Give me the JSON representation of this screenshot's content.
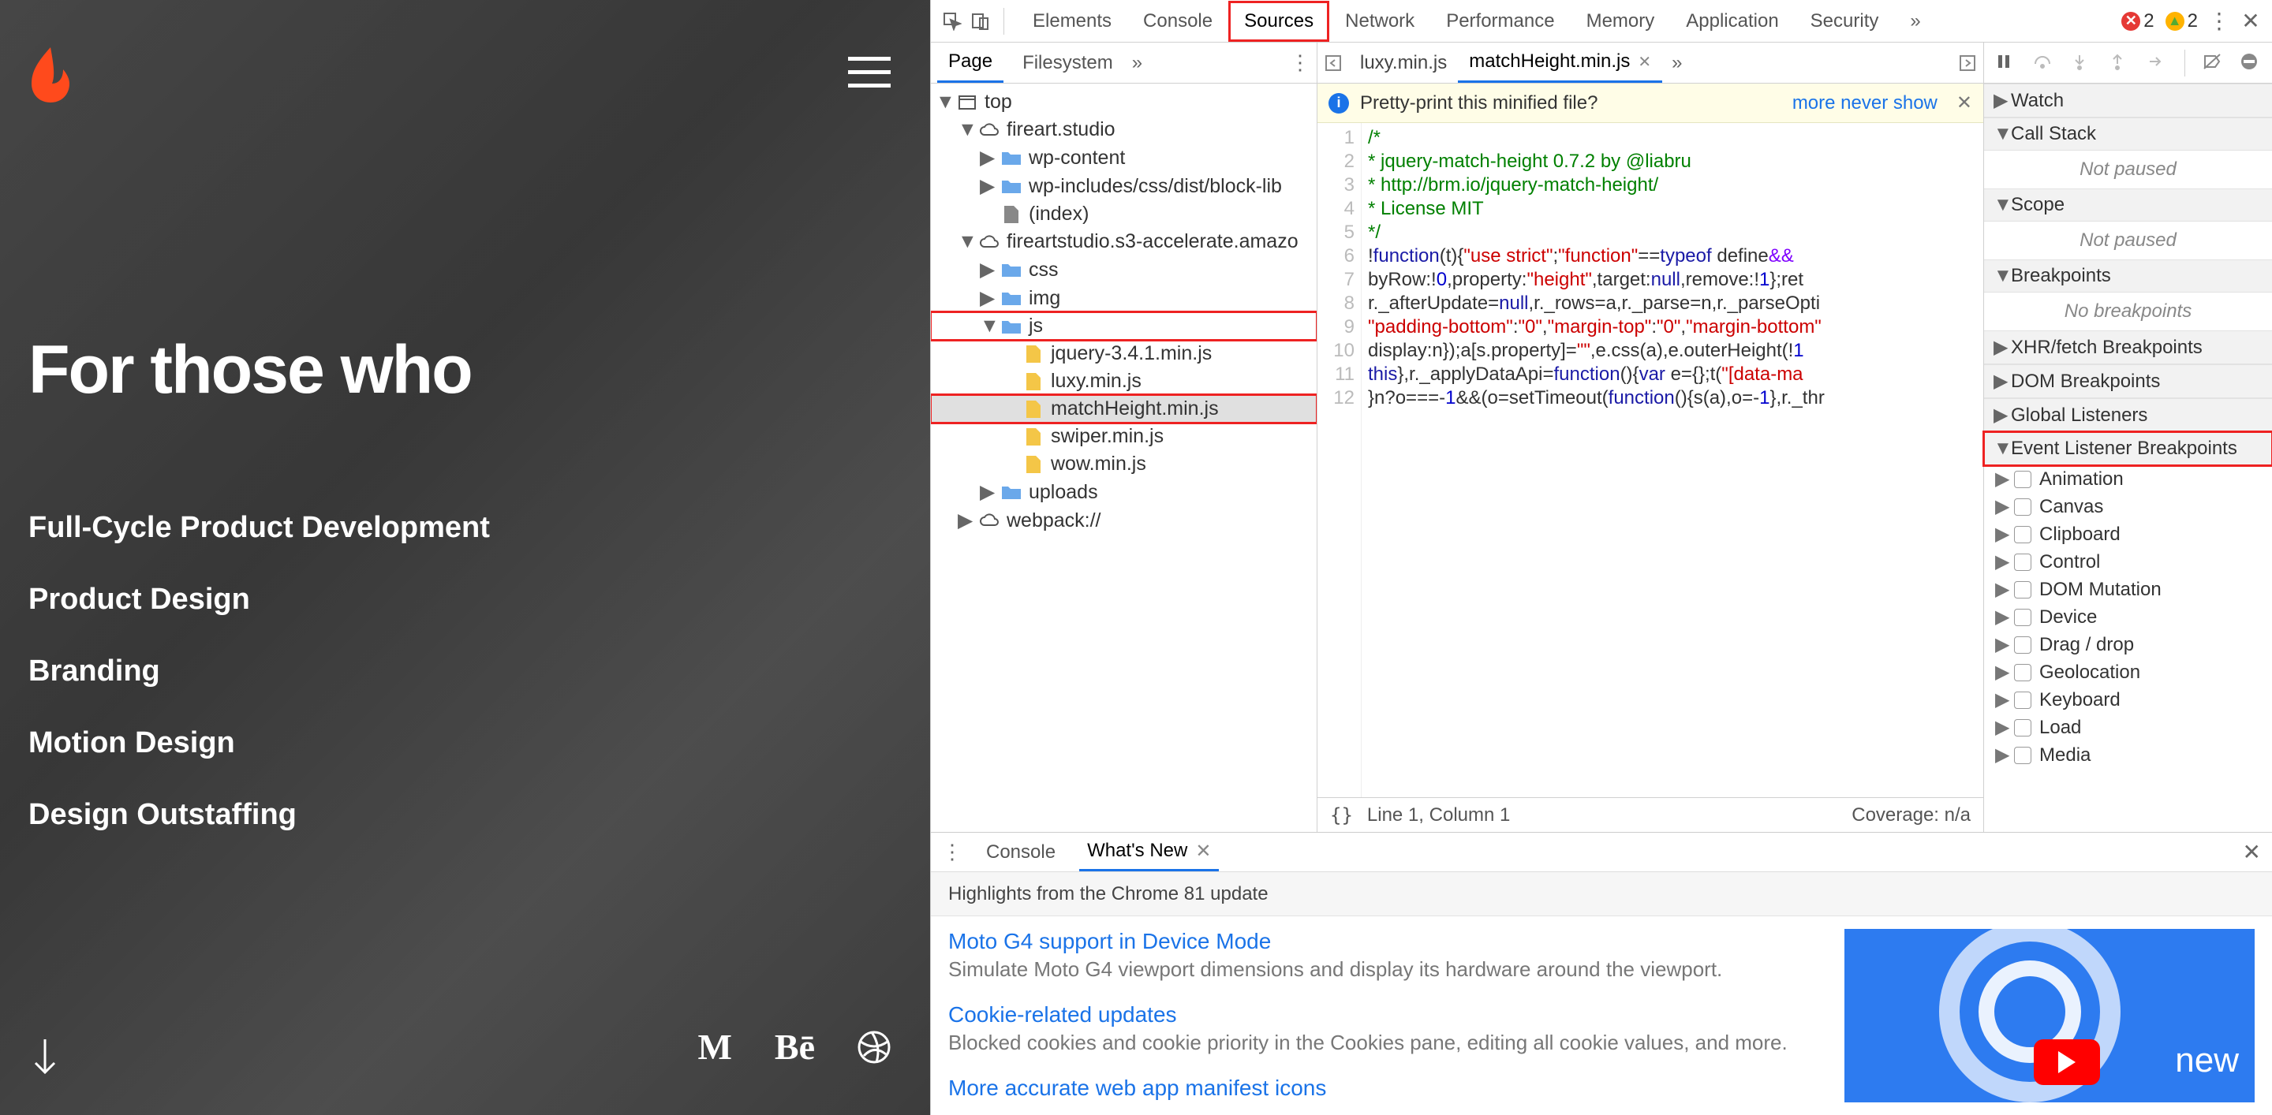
{
  "site": {
    "hero": "For those who",
    "links": [
      "Full-Cycle Product Development",
      "Product Design",
      "Branding",
      "Motion Design",
      "Design Outstaffing"
    ]
  },
  "devtools": {
    "tabs": [
      "Elements",
      "Console",
      "Sources",
      "Network",
      "Performance",
      "Memory",
      "Application",
      "Security"
    ],
    "active_tab": "Sources",
    "errors": 2,
    "warnings": 2,
    "nav": {
      "tabs": [
        "Page",
        "Filesystem"
      ],
      "active": "Page",
      "tree": {
        "root": "top",
        "domains": [
          {
            "name": "fireart.studio",
            "children": [
              {
                "name": "wp-content",
                "type": "folder"
              },
              {
                "name": "wp-includes/css/dist/block-lib",
                "type": "folder"
              },
              {
                "name": "(index)",
                "type": "file-grey"
              }
            ]
          },
          {
            "name": "fireartstudio.s3-accelerate.amazo",
            "children": [
              {
                "name": "css",
                "type": "folder"
              },
              {
                "name": "img",
                "type": "folder"
              },
              {
                "name": "js",
                "type": "folder-open",
                "children": [
                  {
                    "name": "jquery-3.4.1.min.js",
                    "type": "file"
                  },
                  {
                    "name": "luxy.min.js",
                    "type": "file"
                  },
                  {
                    "name": "matchHeight.min.js",
                    "type": "file",
                    "selected": true
                  },
                  {
                    "name": "swiper.min.js",
                    "type": "file"
                  },
                  {
                    "name": "wow.min.js",
                    "type": "file"
                  }
                ]
              },
              {
                "name": "uploads",
                "type": "folder"
              }
            ]
          },
          {
            "name": "webpack://",
            "type": "cloud"
          }
        ]
      }
    },
    "editor": {
      "open_tabs": [
        "luxy.min.js",
        "matchHeight.min.js"
      ],
      "active_tab": "matchHeight.min.js",
      "pretty_msg": "Pretty-print this minified file?",
      "pretty_link": "more never show",
      "lines": [
        {
          "n": 1,
          "segs": [
            {
              "t": "/*",
              "c": "c-green"
            }
          ]
        },
        {
          "n": 2,
          "segs": [
            {
              "t": "* jquery-match-height 0.7.2 by @liabru",
              "c": "c-green"
            }
          ]
        },
        {
          "n": 3,
          "segs": [
            {
              "t": "* http://brm.io/jquery-match-height/",
              "c": "c-green"
            }
          ]
        },
        {
          "n": 4,
          "segs": [
            {
              "t": "* License MIT",
              "c": "c-green"
            }
          ]
        },
        {
          "n": 5,
          "segs": [
            {
              "t": "*/",
              "c": "c-green"
            }
          ]
        },
        {
          "n": 6,
          "segs": [
            {
              "t": "!",
              "c": ""
            },
            {
              "t": "function",
              "c": "c-kblue"
            },
            {
              "t": "(t){",
              "c": ""
            },
            {
              "t": "\"use strict\"",
              "c": "c-red"
            },
            {
              "t": ";",
              "c": ""
            },
            {
              "t": "\"function\"",
              "c": "c-red"
            },
            {
              "t": "==",
              "c": ""
            },
            {
              "t": "typeof",
              "c": "c-kblue"
            },
            {
              "t": " define",
              "c": ""
            },
            {
              "t": "&&",
              "c": "c-purple"
            }
          ]
        },
        {
          "n": 7,
          "segs": [
            {
              "t": "byRow:!",
              "c": ""
            },
            {
              "t": "0",
              "c": "c-blue"
            },
            {
              "t": ",property:",
              "c": ""
            },
            {
              "t": "\"height\"",
              "c": "c-red"
            },
            {
              "t": ",target:",
              "c": ""
            },
            {
              "t": "null",
              "c": "c-kblue"
            },
            {
              "t": ",remove:!",
              "c": ""
            },
            {
              "t": "1",
              "c": "c-blue"
            },
            {
              "t": "};ret",
              "c": ""
            }
          ]
        },
        {
          "n": 8,
          "segs": [
            {
              "t": "r._afterUpdate=",
              "c": ""
            },
            {
              "t": "null",
              "c": "c-kblue"
            },
            {
              "t": ",r._rows=a,r._parse=n,r._parseOpti",
              "c": ""
            }
          ]
        },
        {
          "n": 9,
          "segs": [
            {
              "t": "\"padding-bottom\"",
              "c": "c-red"
            },
            {
              "t": ":",
              "c": ""
            },
            {
              "t": "\"0\"",
              "c": "c-red"
            },
            {
              "t": ",",
              "c": ""
            },
            {
              "t": "\"margin-top\"",
              "c": "c-red"
            },
            {
              "t": ":",
              "c": ""
            },
            {
              "t": "\"0\"",
              "c": "c-red"
            },
            {
              "t": ",",
              "c": ""
            },
            {
              "t": "\"margin-bottom\"",
              "c": "c-red"
            }
          ]
        },
        {
          "n": 10,
          "segs": [
            {
              "t": "display:n});a[s.property]=",
              "c": ""
            },
            {
              "t": "\"\"",
              "c": "c-red"
            },
            {
              "t": ",e.css(a),e.outerHeight(!",
              "c": ""
            },
            {
              "t": "1",
              "c": "c-blue"
            }
          ]
        },
        {
          "n": 11,
          "segs": [
            {
              "t": "this",
              "c": "c-kblue"
            },
            {
              "t": "},r._applyDataApi=",
              "c": ""
            },
            {
              "t": "function",
              "c": "c-kblue"
            },
            {
              "t": "(){",
              "c": ""
            },
            {
              "t": "var",
              "c": "c-kblue"
            },
            {
              "t": " e={};t(",
              "c": ""
            },
            {
              "t": "\"[data-ma",
              "c": "c-red"
            }
          ]
        },
        {
          "n": 12,
          "segs": [
            {
              "t": "}n?o===-",
              "c": ""
            },
            {
              "t": "1",
              "c": "c-blue"
            },
            {
              "t": "&&(o=setTimeout(",
              "c": ""
            },
            {
              "t": "function",
              "c": "c-kblue"
            },
            {
              "t": "(){s(a),o=-",
              "c": ""
            },
            {
              "t": "1",
              "c": "c-blue"
            },
            {
              "t": "},r._thr",
              "c": ""
            }
          ]
        }
      ],
      "status_pos": "Line 1, Column 1",
      "status_cov": "Coverage: n/a"
    },
    "debug": {
      "panes": [
        {
          "name": "Watch",
          "state": "collapsed"
        },
        {
          "name": "Call Stack",
          "state": "open",
          "body": "Not paused"
        },
        {
          "name": "Scope",
          "state": "open",
          "body": "Not paused"
        },
        {
          "name": "Breakpoints",
          "state": "open",
          "body": "No breakpoints"
        },
        {
          "name": "XHR/fetch Breakpoints",
          "state": "collapsed"
        },
        {
          "name": "DOM Breakpoints",
          "state": "collapsed"
        },
        {
          "name": "Global Listeners",
          "state": "collapsed"
        },
        {
          "name": "Event Listener Breakpoints",
          "state": "open",
          "highlight": true
        }
      ],
      "elb": [
        "Animation",
        "Canvas",
        "Clipboard",
        "Control",
        "DOM Mutation",
        "Device",
        "Drag / drop",
        "Geolocation",
        "Keyboard",
        "Load",
        "Media"
      ]
    },
    "drawer": {
      "tabs": [
        "Console",
        "What's New"
      ],
      "active": "What's New",
      "subtitle": "Highlights from the Chrome 81 update",
      "news": [
        {
          "title": "Moto G4 support in Device Mode",
          "desc": "Simulate Moto G4 viewport dimensions and display its hardware around the viewport."
        },
        {
          "title": "Cookie-related updates",
          "desc": "Blocked cookies and cookie priority in the Cookies pane, editing all cookie values, and more."
        },
        {
          "title": "More accurate web app manifest icons",
          "desc": ""
        }
      ],
      "promo_label": "new"
    }
  }
}
